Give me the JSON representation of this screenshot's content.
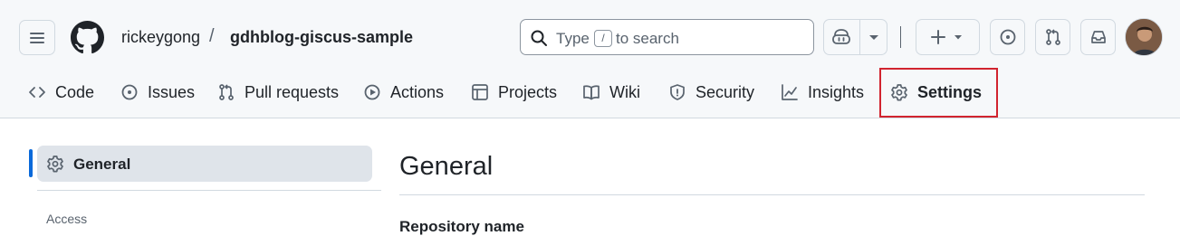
{
  "header": {
    "owner": "rickeygong",
    "separator": "/",
    "repo": "gdhblog-giscus-sample",
    "search": {
      "prefix": "Type",
      "shortcut_key": "/",
      "suffix": "to search"
    },
    "icons": [
      "menu-icon",
      "github-logo-icon",
      "search-icon",
      "copilot-icon",
      "chevron-down-icon",
      "plus-icon",
      "issue-circle-icon",
      "pull-request-icon",
      "inbox-icon"
    ]
  },
  "repo_nav": {
    "tabs": [
      {
        "label": "Code",
        "icon": "code-icon"
      },
      {
        "label": "Issues",
        "icon": "issue-circle-icon"
      },
      {
        "label": "Pull requests",
        "icon": "pull-request-icon"
      },
      {
        "label": "Actions",
        "icon": "play-icon"
      },
      {
        "label": "Projects",
        "icon": "table-icon"
      },
      {
        "label": "Wiki",
        "icon": "book-icon"
      },
      {
        "label": "Security",
        "icon": "shield-icon"
      },
      {
        "label": "Insights",
        "icon": "graph-icon"
      },
      {
        "label": "Settings",
        "icon": "gear-icon",
        "selected": true
      }
    ],
    "highlight_color": "#d1242f"
  },
  "sidebar": {
    "active_item": "General",
    "section_heading": "Access",
    "accent_color": "#0969da"
  },
  "main": {
    "title": "General",
    "field_label": "Repository name"
  }
}
